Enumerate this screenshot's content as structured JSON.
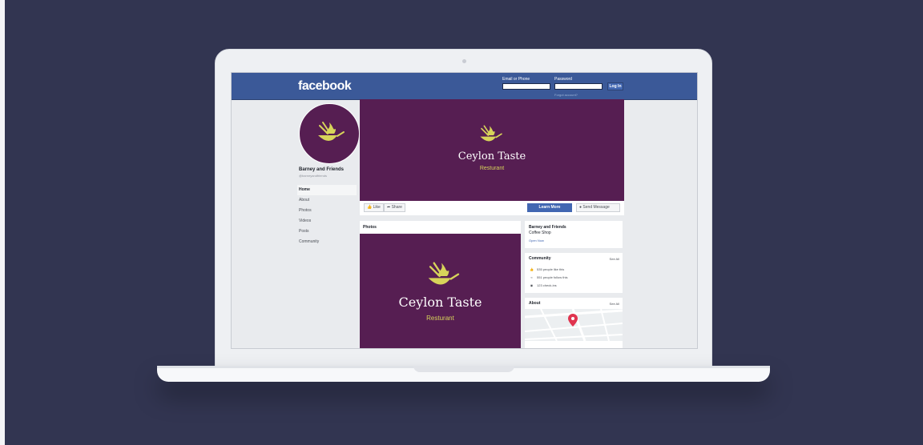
{
  "header": {
    "logo": "facebook",
    "email_label": "Email or Phone",
    "password_label": "Password",
    "login_label": "Log In",
    "forgot_label": "Forgot account?",
    "color": "#3b5998"
  },
  "page": {
    "name": "Barney and Friends",
    "handle": "@barneyandfriends"
  },
  "nav": {
    "items": [
      {
        "label": "Home"
      },
      {
        "label": "About"
      },
      {
        "label": "Photos"
      },
      {
        "label": "Videos"
      },
      {
        "label": "Posts"
      },
      {
        "label": "Community"
      }
    ]
  },
  "brand": {
    "title": "Ceylon Taste",
    "subtitle": "Resturant",
    "purple": "#561e52",
    "accent": "#d7d45a"
  },
  "actions": {
    "like": "Like",
    "share": "Share",
    "learn_more": "Learn More",
    "send_message": "Send Message"
  },
  "photos": {
    "title": "Photos"
  },
  "info_card": {
    "name": "Barney and Friends",
    "category": "Coffee Shop",
    "status": "Open Now"
  },
  "community": {
    "title": "Community",
    "see_all": "See All",
    "likes": "535 people like this",
    "follows": "551 people follow this",
    "checkins": "123 check-ins"
  },
  "about": {
    "title": "About",
    "see_all": "See All"
  }
}
